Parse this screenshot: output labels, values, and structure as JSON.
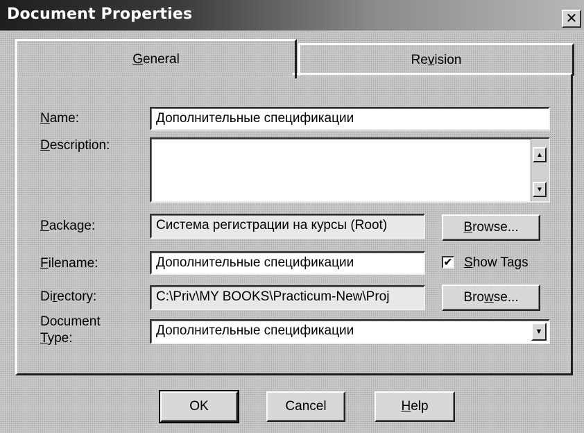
{
  "window": {
    "title": "Document Properties",
    "close_glyph": "✕"
  },
  "tabs": [
    {
      "label": "General",
      "mnemonic": "G",
      "active": true
    },
    {
      "label": "Revision",
      "mnemonic": "v",
      "active": false
    }
  ],
  "form": {
    "name": {
      "label": "Name:",
      "value": "Дополнительные спецификации"
    },
    "description": {
      "label": "Description:",
      "value": ""
    },
    "package": {
      "label": "Package:",
      "value": "Система регистрации на курсы (Root)",
      "browse_label": "Browse..."
    },
    "filename": {
      "label": "Filename:",
      "value": "Дополнительные спецификации"
    },
    "show_tags": {
      "label": "Show Tags",
      "checked": true
    },
    "directory": {
      "label": "Directory:",
      "value": "C:\\Priv\\MY BOOKS\\Practicum-New\\Proj",
      "browse_label": "Browse..."
    },
    "document_type": {
      "label_line1": "Document",
      "label_line2": "Type:",
      "value": "Дополнительные спецификации"
    }
  },
  "buttons": {
    "ok": "OK",
    "cancel": "Cancel",
    "help": "Help"
  },
  "icons": {
    "close": "close-icon",
    "scroll_up": "arrow-up-icon",
    "scroll_down": "arrow-down-icon",
    "dropdown": "chevron-down-icon",
    "check": "checkmark-icon"
  }
}
